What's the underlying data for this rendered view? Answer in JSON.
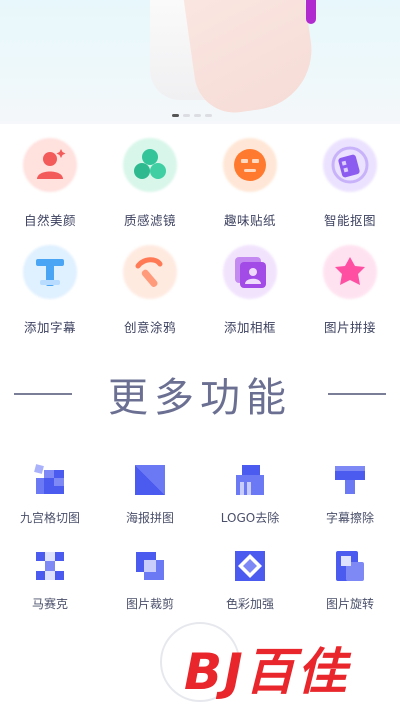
{
  "hero": {
    "active_index": 0,
    "dot_count": 4
  },
  "features": [
    {
      "label": "自然美颜",
      "icon": "person-beauty-icon",
      "color": "#f35a5a",
      "glow": "#ffc9c4"
    },
    {
      "label": "质感滤镜",
      "icon": "filter-circles-icon",
      "color": "#34c49a",
      "glow": "#b9efd9"
    },
    {
      "label": "趣味贴纸",
      "icon": "sticker-face-icon",
      "color": "#ff7a2e",
      "glow": "#ffd3b5"
    },
    {
      "label": "智能抠图",
      "icon": "smart-cutout-icon",
      "color": "#8c5bf0",
      "glow": "#dccbff"
    },
    {
      "label": "添加字幕",
      "icon": "text-t-icon",
      "color": "#4aa6f5",
      "glow": "#c6e4ff"
    },
    {
      "label": "创意涂鸦",
      "icon": "doodle-brush-icon",
      "color": "#ff7a55",
      "glow": "#ffd9c8"
    },
    {
      "label": "添加相框",
      "icon": "photo-frame-icon",
      "color": "#a24be6",
      "glow": "#e6cdfb"
    },
    {
      "label": "图片拼接",
      "icon": "puzzle-piece-icon",
      "color": "#ff4fa3",
      "glow": "#ffcce4"
    }
  ],
  "more_title": "更多功能",
  "tools": [
    {
      "label": "九宫格切图",
      "icon": "nine-grid-icon"
    },
    {
      "label": "海报拼图",
      "icon": "poster-collage-icon"
    },
    {
      "label": "LOGO去除",
      "icon": "logo-remove-icon"
    },
    {
      "label": "字幕擦除",
      "icon": "subtitle-erase-icon"
    },
    {
      "label": "马赛克",
      "icon": "mosaic-icon"
    },
    {
      "label": "图片裁剪",
      "icon": "crop-icon"
    },
    {
      "label": "色彩加强",
      "icon": "color-enhance-icon"
    },
    {
      "label": "图片旋转",
      "icon": "rotate-icon"
    }
  ],
  "brand": {
    "text": "百佳",
    "mark": "BJ",
    "color": "#e8262b"
  },
  "colors": {
    "tool_primary": "#4b5bf0",
    "tool_light": "#a9b2fb"
  }
}
